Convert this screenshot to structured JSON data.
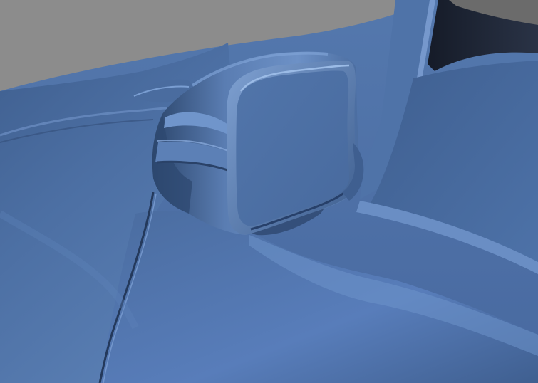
{
  "scene": {
    "subject": "car-side-mirror-3d-clay-render",
    "colors": {
      "background": "#8c8c8c",
      "body_base": "#4a6b9c",
      "body_light": "#6a8dc0",
      "body_highlight": "#88a9d6",
      "body_dark": "#2f4a72",
      "body_shadow": "#23395a",
      "glass_dark": "#1c2333"
    }
  }
}
